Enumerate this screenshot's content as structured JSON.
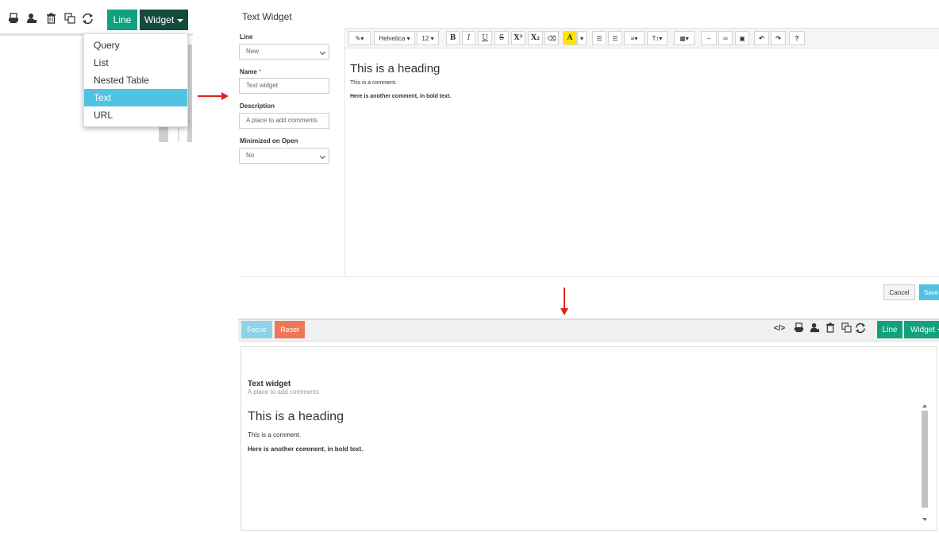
{
  "top_panel": {
    "icons": [
      "print-icon",
      "user-icon",
      "trash-icon",
      "copy-icon",
      "refresh-icon"
    ],
    "line_button": "Line",
    "widget_button": "Widget",
    "dropdown_items": [
      {
        "label": "Query",
        "active": false
      },
      {
        "label": "List",
        "active": false
      },
      {
        "label": "Nested Table",
        "active": false
      },
      {
        "label": "Text",
        "active": true
      },
      {
        "label": "URL",
        "active": false
      }
    ]
  },
  "editor": {
    "title": "Text Widget",
    "form": {
      "line_label": "Line",
      "line_value": "New",
      "name_label": "Name",
      "name_required": "*",
      "name_value": "Text widget",
      "description_label": "Description",
      "description_placeholder": "A place to add comments",
      "minimized_label": "Minimized on Open",
      "minimized_value": "No"
    },
    "toolbar": {
      "magic": "✎▾",
      "font": "Helvetica ▾",
      "size": "12 ▾",
      "bold": "B",
      "italic": "I",
      "underline": "U",
      "strike": "S",
      "superscript": "X²",
      "subscript": "X₂",
      "eraser": "⌫",
      "highlight": "A",
      "highlight_caret": "▾",
      "ul": "☰",
      "ol": "☰",
      "align": "≡▾",
      "line_height": "T↕▾",
      "table": "▦▾",
      "hr": "–",
      "link": "∞",
      "picture": "▣",
      "undo": "↶",
      "redo": "↷",
      "help": "?"
    },
    "content": {
      "heading": "This is a heading",
      "comment": "This is a comment.",
      "bold_text": "Here is another comment, in bold text."
    },
    "cancel_button": "Cancel",
    "save_button": "Save"
  },
  "result": {
    "focus_button": "Focus",
    "reset_button": "Reset",
    "line_button": "Line",
    "widget_button": "Widget",
    "code_icon": "</>",
    "widget_title": "Text widget",
    "widget_description": "A place to add comments",
    "heading": "This is a heading",
    "comment": "This is a comment.",
    "bold_text": "Here is another comment, in bold text."
  },
  "colors": {
    "line_green": "#13a07f",
    "widget_dark": "#134b3c",
    "active_blue": "#4fc3e1",
    "focus_blue": "#8dd2e6",
    "reset_orange": "#ef7658",
    "arrow_red": "#e0211c"
  }
}
